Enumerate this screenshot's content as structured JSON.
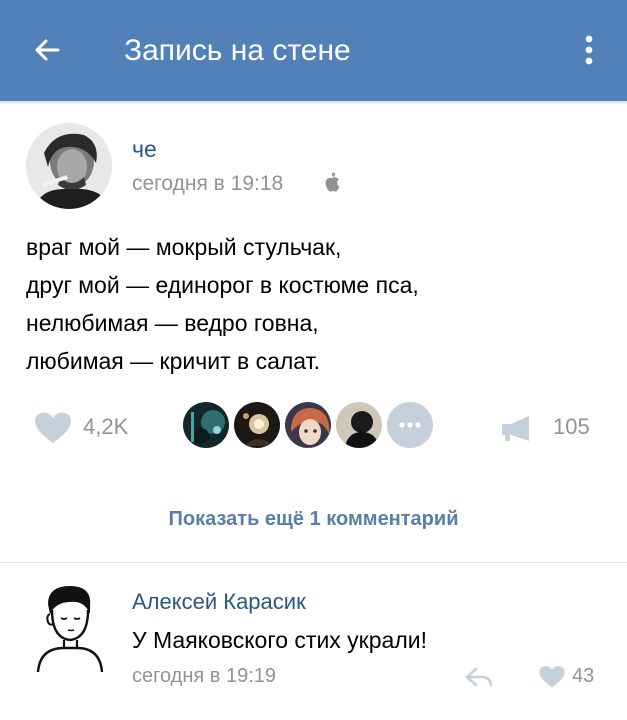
{
  "header": {
    "title": "Запись на стене",
    "back_icon": "arrow-left-icon",
    "menu_icon": "more-vertical-icon",
    "background": "#5181b8"
  },
  "post": {
    "author": "че",
    "time": "сегодня в 19:18",
    "platform_icon": "apple-icon",
    "lines": [
      "враг мой — мокрый стульчак,",
      "друг мой — единорог в костюме пса,",
      "нелюбимая — ведро говна,",
      "любимая — кричит в салат."
    ],
    "likes": "4,2K",
    "reposts": "105"
  },
  "show_more": "Показать ещё 1 комментарий",
  "comment": {
    "author": "Алексей Карасик",
    "text": "У Маяковского стих украли!",
    "time": "сегодня в 19:19",
    "likes": "43"
  },
  "colors": {
    "link": "#2a5885",
    "muted": "#939393",
    "accent": "#5181b8"
  }
}
